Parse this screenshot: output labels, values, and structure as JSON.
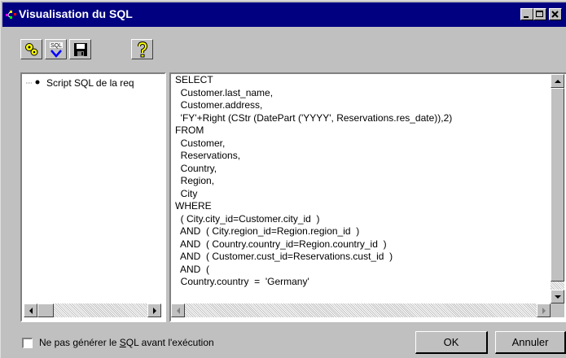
{
  "window": {
    "title": "Visualisation du SQL"
  },
  "tree": {
    "item_label": "Script SQL de la req"
  },
  "sql": {
    "text": "SELECT\n  Customer.last_name,\n  Customer.address,\n  'FY'+Right (CStr (DatePart ('YYYY', Reservations.res_date)),2)\nFROM\n  Customer,\n  Reservations,\n  Country,\n  Region,\n  City\nWHERE\n  ( City.city_id=Customer.city_id  )\n  AND  ( City.region_id=Region.region_id  )\n  AND  ( Country.country_id=Region.country_id  )\n  AND  ( Customer.cust_id=Reservations.cust_id  )\n  AND  (\n  Country.country  =  'Germany'"
  },
  "footer": {
    "checkbox_prefix": "Ne pas générer le ",
    "checkbox_underlined": "S",
    "checkbox_suffix": "QL avant l'exécution",
    "ok_label": "OK",
    "cancel_label": "Annuler"
  },
  "icons": [
    "properties-icon",
    "sql-check-icon",
    "save-icon",
    "help-icon"
  ],
  "colors": {
    "title_bar": "#000080",
    "face": "#c0c0c0",
    "help_yellow": "#ffff00"
  }
}
